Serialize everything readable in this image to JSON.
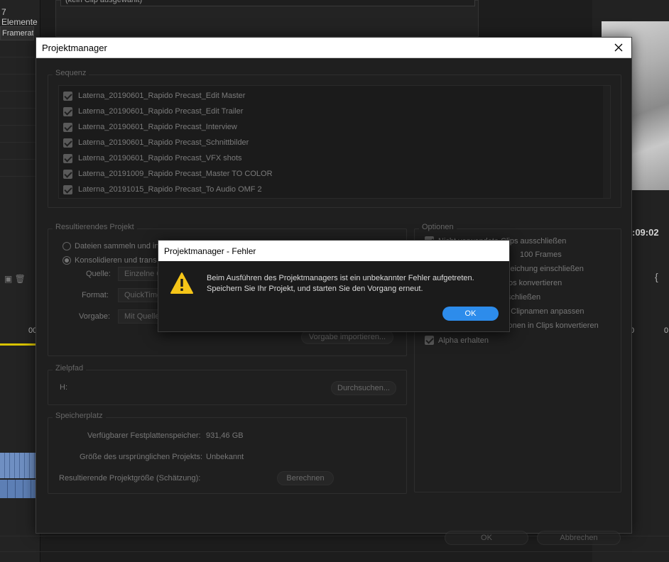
{
  "background": {
    "element_count": "7 Elemente",
    "column_header": "Framerate",
    "clip_field": "(kein Clip ausgewählt)",
    "timecode": ":09:02",
    "ruler_left": "00",
    "ruler_right_a": "0",
    "ruler_right_b": "0"
  },
  "project_manager": {
    "title": "Projektmanager",
    "sequence": {
      "legend": "Sequenz",
      "items": [
        {
          "label": "Laterna_20190601_Rapido Precast_Edit Master",
          "checked": true
        },
        {
          "label": "Laterna_20190601_Rapido Precast_Edit Trailer",
          "checked": true
        },
        {
          "label": "Laterna_20190601_Rapido Precast_Interview",
          "checked": true
        },
        {
          "label": "Laterna_20190601_Rapido Precast_Schnittbilder",
          "checked": true
        },
        {
          "label": "Laterna_20190601_Rapido Precast_VFX shots",
          "checked": true
        },
        {
          "label": "Laterna_20191009_Rapido Precast_Master TO COLOR",
          "checked": true
        },
        {
          "label": "Laterna_20191015_Rapido Precast_To Audio OMF 2",
          "checked": true
        }
      ]
    },
    "resulting_project": {
      "legend": "Resultierendes Projekt",
      "radio_collect": "Dateien sammeln und in",
      "radio_consolidate": "Konsolidieren und trans",
      "source_label": "Quelle:",
      "source_value": "Einzelne C",
      "format_label": "Format:",
      "format_value": "QuickTime",
      "preset_label": "Vorgabe:",
      "preset_value": "Mit Quelle",
      "import_preset_button": "Vorgabe importieren..."
    },
    "options": {
      "legend": "Optionen",
      "items": [
        {
          "label": "Nicht verwendete Clips ausschließen",
          "checked": true
        },
        {
          "label": "100 Frames",
          "checked": false
        },
        {
          "label": "gleichung einschließen",
          "checked": false
        },
        {
          "label": "os konvertieren",
          "checked": false
        },
        {
          "label": "schließen",
          "checked": false
        },
        {
          "label": "n Clipnamen anpassen",
          "checked": false
        },
        {
          "label": "tionen in Clips konvertieren",
          "checked": false
        },
        {
          "label": "Alpha erhalten",
          "checked": true
        }
      ]
    },
    "target_path": {
      "legend": "Zielpfad",
      "path": "H:",
      "browse_button": "Durchsuchen..."
    },
    "disk_space": {
      "legend": "Speicherplatz",
      "available_label": "Verfügbarer Festplattenspeicher:",
      "available_value": "931,46 GB",
      "original_size_label": "Größe des ursprünglichen Projekts:",
      "original_size_value": "Unbekannt",
      "resulting_size_label": "Resultierende Projektgröße (Schätzung):",
      "calculate_button": "Berechnen"
    },
    "ok_button": "OK",
    "cancel_button": "Abbrechen"
  },
  "error_dialog": {
    "title": "Projektmanager - Fehler",
    "icon": "warning-icon",
    "message_line1": "Beim Ausführen des Projektmanagers ist ein unbekannter Fehler aufgetreten.",
    "message_line2": "Speichern Sie Ihr Projekt, und starten Sie den Vorgang erneut.",
    "ok_button": "OK",
    "accent_color": "#2d8ceb",
    "warning_color": "#f5c518"
  }
}
